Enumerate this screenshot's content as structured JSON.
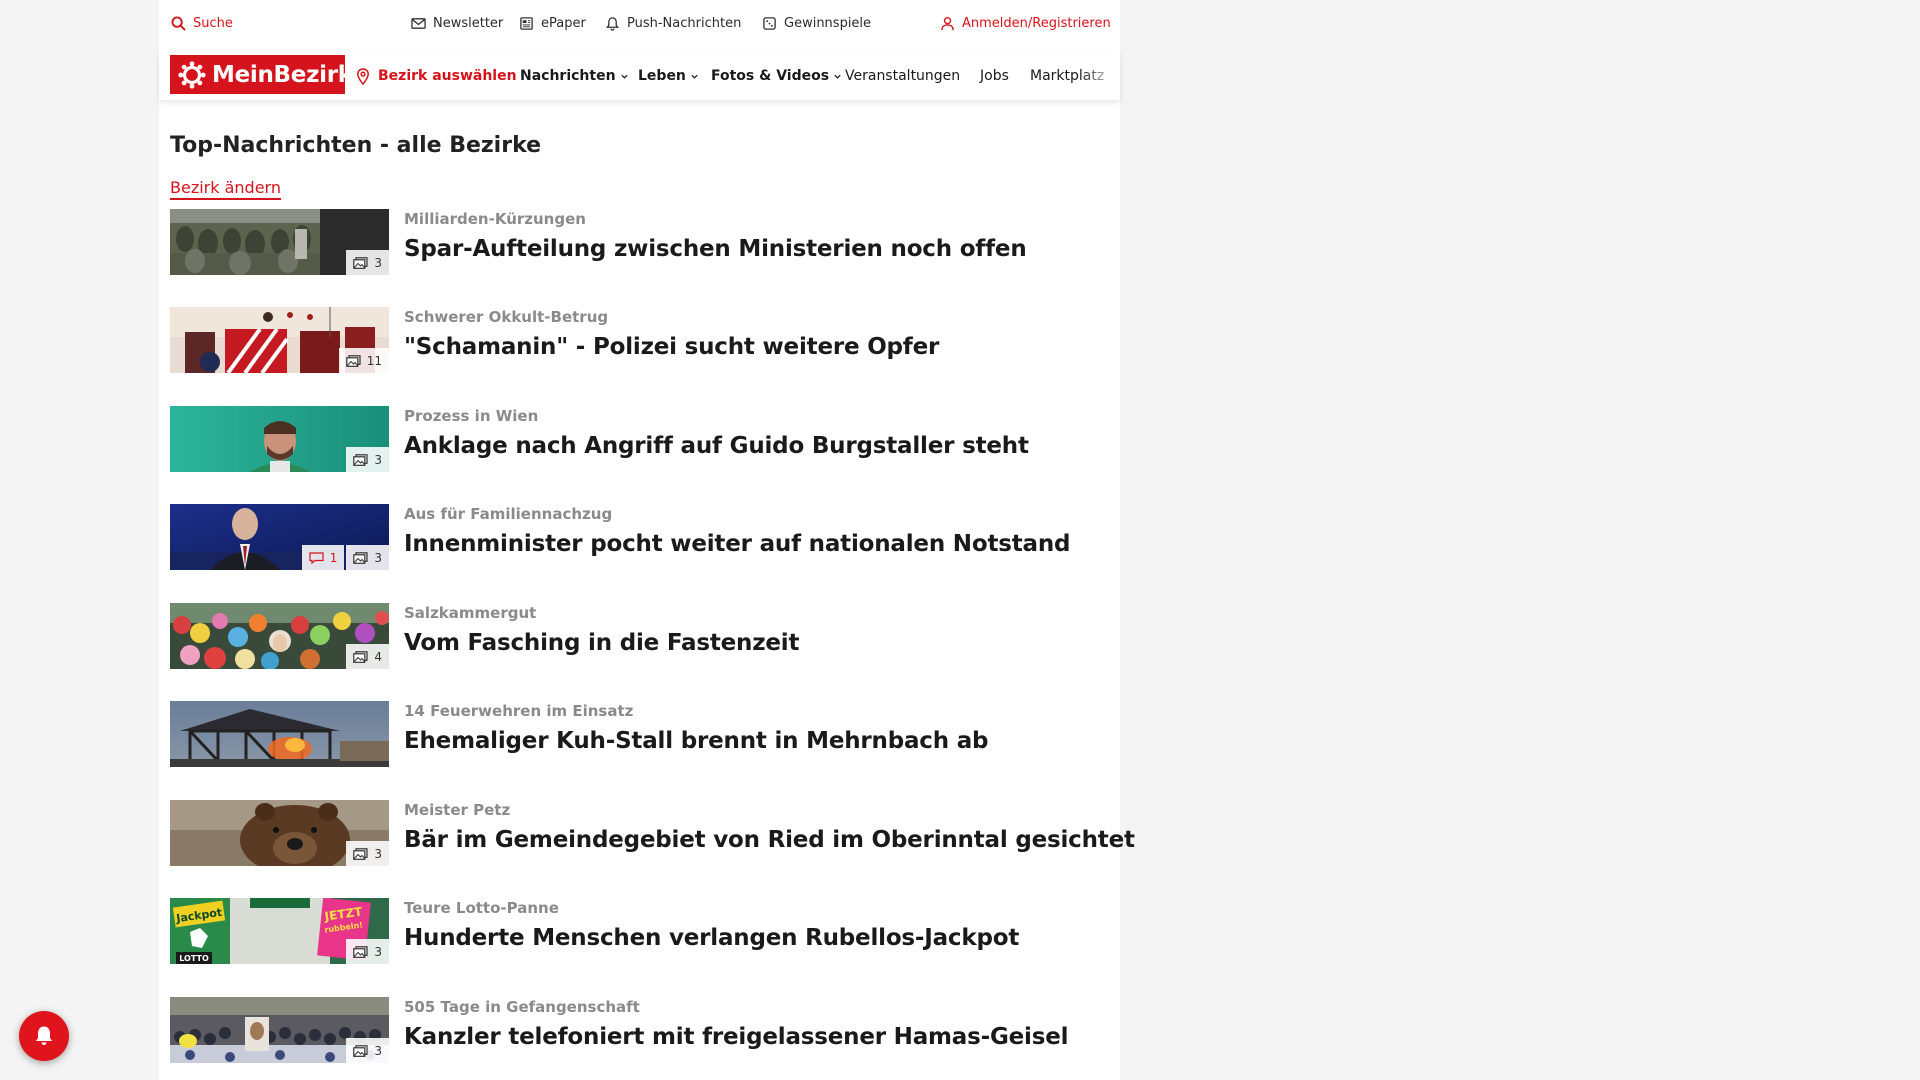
{
  "utility_bar": {
    "search": "Suche",
    "newsletter": "Newsletter",
    "epaper": "ePaper",
    "push": "Push-Nachrichten",
    "gewinnspiele": "Gewinnspiele",
    "login": "Anmelden/Registrieren"
  },
  "nav": {
    "logo": "MeinBezirk",
    "district_select": "Bezirk auswählen",
    "items": [
      {
        "label": "Nachrichten",
        "dropdown": true
      },
      {
        "label": "Leben",
        "dropdown": true
      },
      {
        "label": "Fotos & Videos",
        "dropdown": true
      },
      {
        "label": "Veranstaltungen",
        "dropdown": false
      },
      {
        "label": "Jobs",
        "dropdown": false
      },
      {
        "label": "Marktplatz",
        "dropdown": false
      }
    ]
  },
  "main": {
    "title": "Top-Nachrichten - alle Bezirke",
    "change_district": "Bezirk ändern",
    "articles": [
      {
        "kicker": "Milliarden-Kürzungen",
        "headline": "Spar-Aufteilung zwischen Ministerien noch offen",
        "images": "3",
        "comments": ""
      },
      {
        "kicker": "Schwerer Okkult-Betrug",
        "headline": "\"Schamanin\" - Polizei sucht weitere Opfer",
        "images": "11",
        "comments": ""
      },
      {
        "kicker": "Prozess in Wien",
        "headline": "Anklage nach Angriff auf Guido Burgstaller steht",
        "images": "3",
        "comments": ""
      },
      {
        "kicker": "Aus für Familiennachzug",
        "headline": "Innenminister pocht weiter auf nationalen Notstand",
        "images": "3",
        "comments": "1"
      },
      {
        "kicker": "Salzkammergut",
        "headline": "Vom Fasching in die Fastenzeit",
        "images": "4",
        "comments": ""
      },
      {
        "kicker": "14 Feuerwehren im Einsatz",
        "headline": "Ehemaliger Kuh-Stall brennt in Mehrnbach ab",
        "images": "",
        "comments": ""
      },
      {
        "kicker": "Meister Petz",
        "headline": "Bär im Gemeindegebiet von Ried im Oberinntal gesichtet",
        "images": "3",
        "comments": ""
      },
      {
        "kicker": "Teure Lotto-Panne",
        "headline": "Hunderte Menschen verlangen Rubellos-Jackpot",
        "images": "3",
        "comments": ""
      },
      {
        "kicker": "505 Tage in Gefangenschaft",
        "headline": "Kanzler telefoniert mit freigelassener Hamas-Geisel",
        "images": "3",
        "comments": ""
      }
    ]
  },
  "thumbs": {
    "t8_text1": "Jackpot",
    "t8_text2": "JETZT",
    "t8_text3": "rubbeln!",
    "t8_text4": "LOTTO"
  },
  "colors": {
    "brand": "#d5131c",
    "kicker": "#8a8a8a",
    "text": "#1a1a1a"
  }
}
